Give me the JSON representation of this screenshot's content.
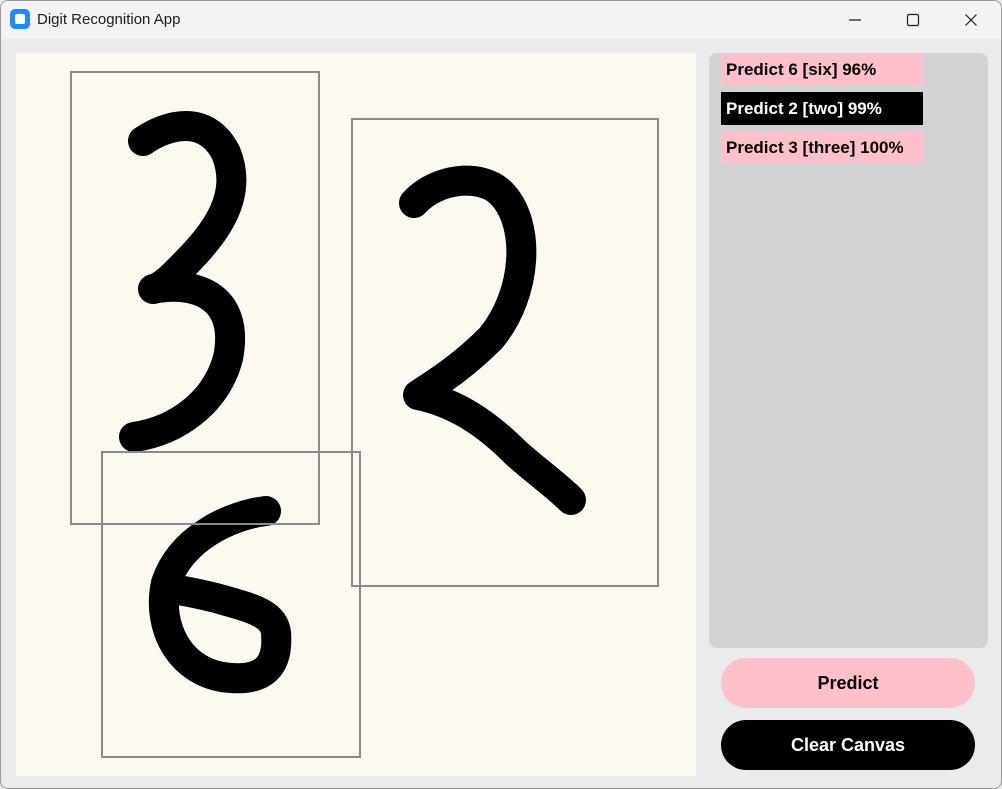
{
  "window": {
    "title": "Digit Recognition App",
    "controls": [
      "minimize",
      "maximize",
      "close"
    ]
  },
  "canvas": {
    "background": "#fdf8f0",
    "stroke_color": "#000000",
    "box_color": "#8a8a8a"
  },
  "predictions": [
    {
      "text": "Predict 6 [six] 96%",
      "style": "pink"
    },
    {
      "text": "Predict 2 [two] 99%",
      "style": "black"
    },
    {
      "text": "Predict 3 [three] 100%",
      "style": "pink"
    }
  ],
  "buttons": {
    "predict_label": "Predict",
    "clear_label": "Clear Canvas"
  },
  "colors": {
    "pink": "#ffc0cb",
    "black": "#000000",
    "panel": "#d3d3d3"
  }
}
